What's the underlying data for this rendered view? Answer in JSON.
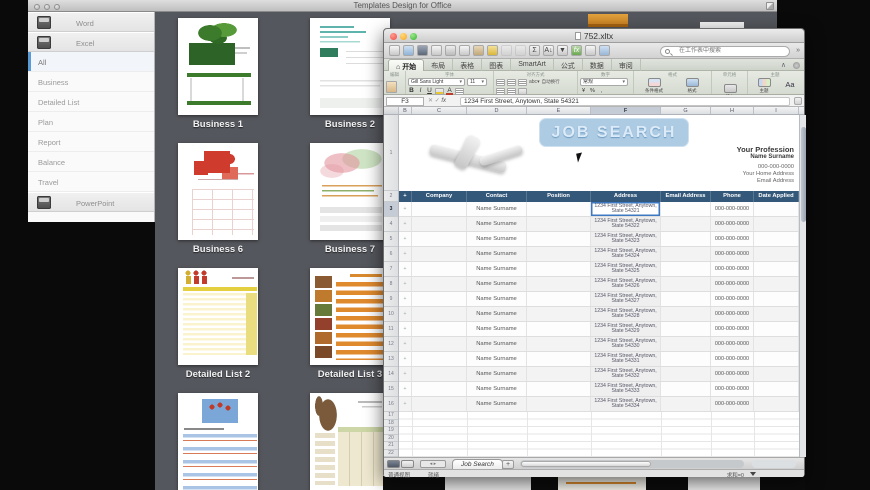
{
  "screen": {
    "title": "Templates Design for Office"
  },
  "colors": {
    "browser_bg": "#54575d",
    "table_header_blue": "#33587a",
    "banner_blue": "#98bedc",
    "selection_blue": "#3d79c2"
  },
  "templates": {
    "sidebar": {
      "apps": [
        {
          "label": "Word"
        },
        {
          "label": "Excel"
        }
      ],
      "categories": [
        "All",
        "Business",
        "Detailed List",
        "Plan",
        "Report",
        "Balance",
        "Travel"
      ],
      "selected": "All",
      "footer_app": {
        "label": "PowerPoint"
      }
    },
    "thumbnails": [
      {
        "label": "Business 1",
        "kind": "green-table"
      },
      {
        "label": "Business 2",
        "kind": "teal-report"
      },
      {
        "label": "Business 6",
        "kind": "red-puzzle"
      },
      {
        "label": "Business 7",
        "kind": "pastel-report"
      },
      {
        "label": "Detailed List 2",
        "kind": "yellow-list"
      },
      {
        "label": "Detailed List 3",
        "kind": "food-list"
      },
      {
        "label": "",
        "kind": "blue-striped-list"
      },
      {
        "label": "",
        "kind": "tan-table"
      }
    ]
  },
  "excel": {
    "window_title": "752.xltx",
    "toolbar": {
      "icons": [
        "new",
        "open",
        "save",
        "print",
        "cut",
        "copy",
        "paste",
        "format-brush",
        "undo",
        "redo",
        "autosum",
        "sort-az",
        "filter",
        "formula-builder",
        "gallery",
        "print-preview"
      ],
      "search_placeholder": "在工作表中搜索",
      "more_label": "»"
    },
    "tabs": [
      "开始",
      "布局",
      "表格",
      "图表",
      "SmartArt",
      "公式",
      "数据",
      "审阅"
    ],
    "active_tab": "开始",
    "ribbon": {
      "groups": [
        "编辑",
        "字体",
        "对齐方式",
        "数字",
        "格式",
        "单元格",
        "主题"
      ],
      "font_name": "Gill Sans Light",
      "font_size": "11",
      "bold": "B",
      "italic": "I",
      "underline": "U",
      "abc_label": "abc",
      "wrap_label": "自动换行",
      "number_format": "常规",
      "big_buttons": [
        "条件格式",
        "格式",
        "插入",
        "主题"
      ],
      "aa_label": "Aa"
    },
    "formula_bar": {
      "cell_ref": "F3",
      "fx_label": "fx",
      "value": "1234 First Street, Anytown, State 54321"
    },
    "grid": {
      "column_letters": [
        "B",
        "C",
        "D",
        "E",
        "F",
        "G",
        "H",
        "I"
      ],
      "selected_column": "F",
      "row_numbers": [
        "1",
        "2",
        "3",
        "4",
        "5",
        "6",
        "7",
        "8",
        "9",
        "10",
        "11",
        "12",
        "13",
        "14",
        "15",
        "16",
        "17",
        "18",
        "19",
        "20",
        "21",
        "22"
      ],
      "selected_row": "3"
    },
    "banner": {
      "title": "JOB SEARCH",
      "profession": "Your Profession",
      "name": "Name Surname",
      "phone": "000-000-0000",
      "home_address": "Your Home Address",
      "email": "Email Address"
    },
    "table": {
      "marker": "+",
      "headers": [
        "Company",
        "Contact",
        "Position",
        "Address",
        "Email Address",
        "Phone",
        "Date Applied"
      ],
      "rows": [
        {
          "contact": "Name Surname",
          "address_line1": "1234 First Street, Anytown,",
          "address_line2": "State 54321",
          "phone": "000-000-0000"
        },
        {
          "contact": "Name Surname",
          "address_line1": "1234 First Street, Anytown,",
          "address_line2": "State 54322",
          "phone": "000-000-0000"
        },
        {
          "contact": "Name Surname",
          "address_line1": "1234 First Street, Anytown,",
          "address_line2": "State 54323",
          "phone": "000-000-0000"
        },
        {
          "contact": "Name Surname",
          "address_line1": "1234 First Street, Anytown,",
          "address_line2": "State 54324",
          "phone": "000-000-0000"
        },
        {
          "contact": "Name Surname",
          "address_line1": "1234 First Street, Anytown,",
          "address_line2": "State 54325",
          "phone": "000-000-0000"
        },
        {
          "contact": "Name Surname",
          "address_line1": "1234 First Street, Anytown,",
          "address_line2": "State 54326",
          "phone": "000-000-0000"
        },
        {
          "contact": "Name Surname",
          "address_line1": "1234 First Street, Anytown,",
          "address_line2": "State 54327",
          "phone": "000-000-0000"
        },
        {
          "contact": "Name Surname",
          "address_line1": "1234 First Street, Anytown,",
          "address_line2": "State 54328",
          "phone": "000-000-0000"
        },
        {
          "contact": "Name Surname",
          "address_line1": "1234 First Street, Anytown,",
          "address_line2": "State 54329",
          "phone": "000-000-0000"
        },
        {
          "contact": "Name Surname",
          "address_line1": "1234 First Street, Anytown,",
          "address_line2": "State 54330",
          "phone": "000-000-0000"
        },
        {
          "contact": "Name Surname",
          "address_line1": "1234 First Street, Anytown,",
          "address_line2": "State 54331",
          "phone": "000-000-0000"
        },
        {
          "contact": "Name Surname",
          "address_line1": "1234 First Street, Anytown,",
          "address_line2": "State 54332",
          "phone": "000-000-0000"
        },
        {
          "contact": "Name Surname",
          "address_line1": "1234 First Street, Anytown,",
          "address_line2": "State 54333",
          "phone": "000-000-0000"
        },
        {
          "contact": "Name Surname",
          "address_line1": "1234 First Street, Anytown,",
          "address_line2": "State 54334",
          "phone": "000-000-0000"
        }
      ]
    },
    "sheet_tabs": {
      "active": "Job Search",
      "add_label": "+"
    },
    "status_bar": {
      "view": "普通视图",
      "ready": "就绪",
      "sum": "求和=0"
    }
  }
}
